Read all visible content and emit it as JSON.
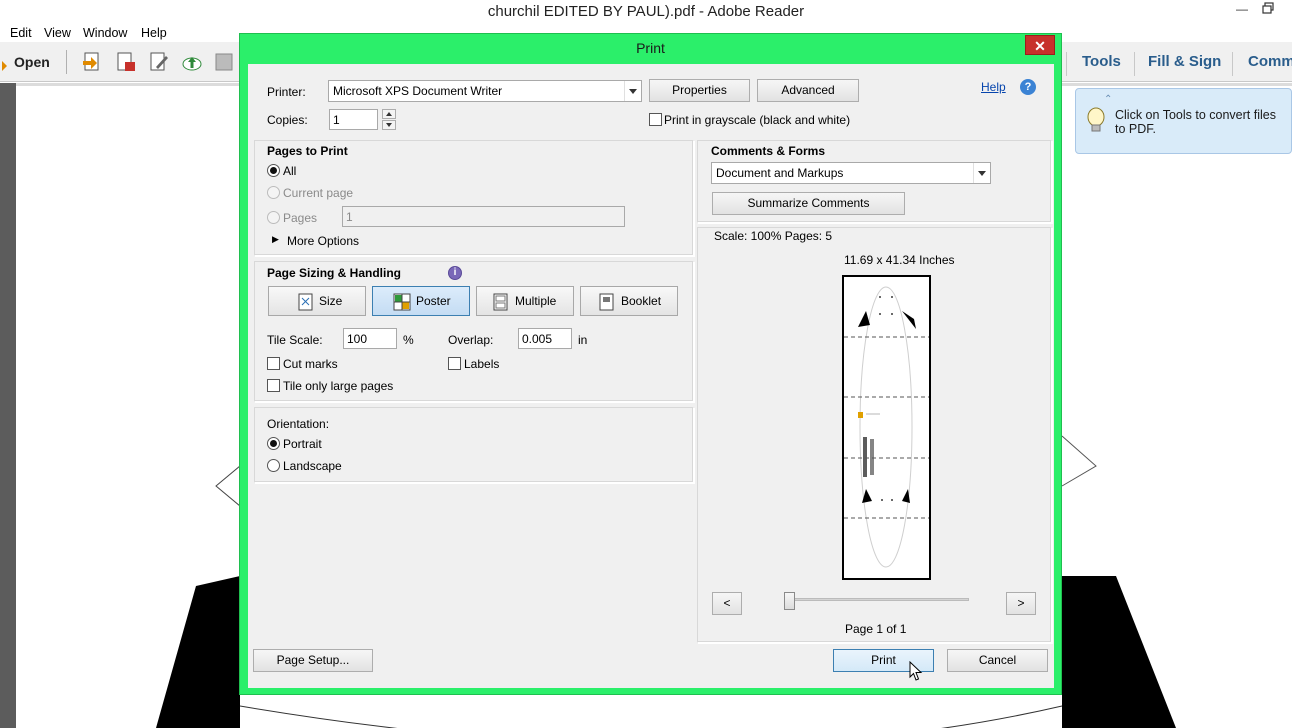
{
  "app": {
    "title": "churchil EDITED BY PAUL).pdf - Adobe Reader",
    "menu": [
      "Edit",
      "View",
      "Window",
      "Help"
    ],
    "toolbar": {
      "open_label": "Open",
      "right_tabs": [
        "Tools",
        "Fill & Sign",
        "Comm"
      ]
    },
    "tip": "Click on Tools to convert files to PDF."
  },
  "dialog": {
    "title": "Print",
    "close_glyph": "✕",
    "printer_label": "Printer:",
    "printer_value": "Microsoft XPS Document Writer",
    "properties_label": "Properties",
    "advanced_label": "Advanced",
    "help_label": "Help",
    "copies_label": "Copies:",
    "copies_value": "1",
    "grayscale_label": "Print in grayscale (black and white)",
    "pages_to_print": {
      "title": "Pages to Print",
      "all_label": "All",
      "current_label": "Current page",
      "pages_label": "Pages",
      "pages_value": "1",
      "more_options_label": "More Options"
    },
    "page_sizing": {
      "title": "Page Sizing & Handling",
      "info_glyph": "i",
      "buttons": [
        "Size",
        "Poster",
        "Multiple",
        "Booklet"
      ],
      "active": "Poster",
      "tile_scale_label": "Tile Scale:",
      "tile_scale_value": "100",
      "tile_scale_unit": "%",
      "overlap_label": "Overlap:",
      "overlap_value": "0.005",
      "overlap_unit": "in",
      "cut_marks_label": "Cut marks",
      "labels_label": "Labels",
      "tile_large_label": "Tile only large pages"
    },
    "orientation": {
      "title": "Orientation:",
      "portrait_label": "Portrait",
      "landscape_label": "Landscape",
      "selected": "Portrait"
    },
    "comments_forms": {
      "title": "Comments & Forms",
      "value": "Document and Markups",
      "summarize_label": "Summarize Comments"
    },
    "preview": {
      "scale_text": "Scale: 100% Pages: 5",
      "size_text": "11.69 x 41.34 Inches",
      "prev_label": "<",
      "next_label": ">",
      "page_text": "Page 1 of 1",
      "slider_fraction": 0.0
    },
    "page_setup_label": "Page Setup...",
    "print_label": "Print",
    "cancel_label": "Cancel"
  },
  "colors": {
    "dialog_frame": "#2bef6a",
    "close_button": "#c7312b",
    "default_button_border": "#3c7fb1",
    "toolbar_tab_text": "#2a5d8c",
    "tip_background": "#d9ebf9"
  }
}
